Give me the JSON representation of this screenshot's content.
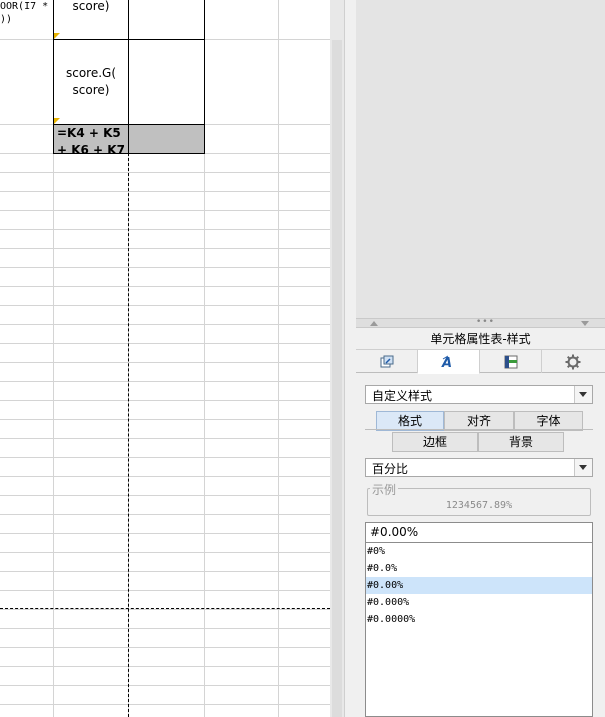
{
  "sheet": {
    "cell_i7_formula_partial": "OOR(I7 *",
    "cell_i7_formula_partial2": "))",
    "cell_j_top_text": "score)",
    "cell_j_mid_text_1": "score.G(",
    "cell_j_mid_text_2": "score)",
    "cell_k_formula_1": "=K4 + K5",
    "cell_k_formula_2": "+ K6 + K7"
  },
  "panel": {
    "title": "单元格属性表-样式",
    "icon_tabs": [
      {
        "name": "cell-link-icon"
      },
      {
        "name": "style-A-icon"
      },
      {
        "name": "cell-border-icon"
      },
      {
        "name": "gear-icon"
      }
    ],
    "style_select": "自定义样式",
    "tabs": [
      "格式",
      "对齐",
      "字体",
      "边框",
      "背景"
    ],
    "format_type_select": "百分比",
    "example_label": "示例",
    "example_value": "1234567.89%",
    "format_input_value": "#0.00%",
    "format_list": [
      "#0%",
      "#0.0%",
      "#0.00%",
      "#0.000%",
      "#0.0000%"
    ],
    "selected_format_index": 2,
    "colors": {
      "selected_tab": "#dbe8f7",
      "selected_item": "#cde4fa",
      "cell_marker": "#e8b400",
      "gray_cell": "#c0c0c0"
    }
  }
}
